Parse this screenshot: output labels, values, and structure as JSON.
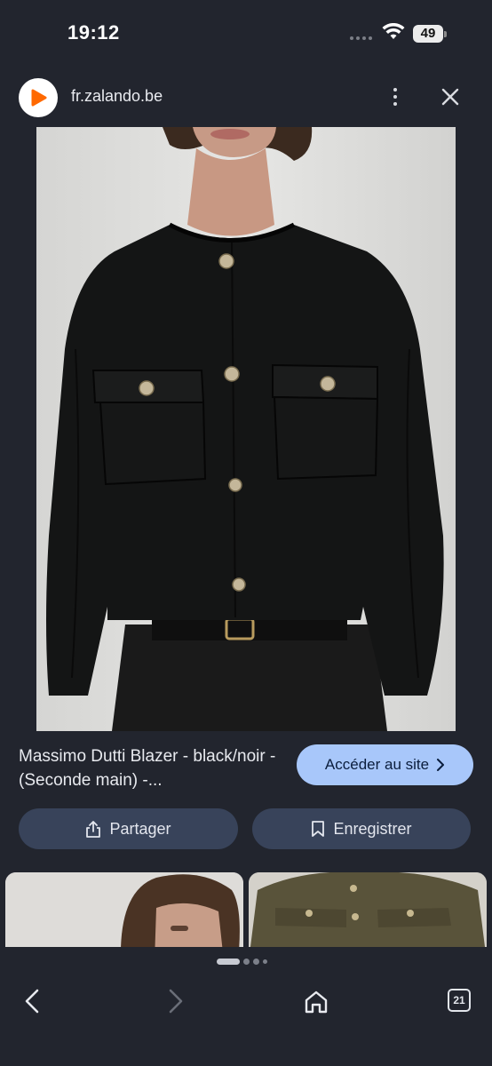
{
  "status_bar": {
    "time": "19:12",
    "battery": "49"
  },
  "browser": {
    "url": "fr.zalando.be",
    "site_icon": "zalando-play-icon",
    "menu_icon": "more-vertical-icon",
    "close_icon": "close-icon"
  },
  "result": {
    "title": "Massimo Dutti Blazer - black/noir - (Seconde main) -...",
    "visit_label": "Accéder au site",
    "share_label": "Partager",
    "save_label": "Enregistrer"
  },
  "bottom_nav": {
    "tab_count": "21",
    "icons": [
      "back-icon",
      "forward-icon",
      "home-icon",
      "tabs-icon"
    ]
  },
  "colors": {
    "background": "#22252e",
    "accent_button": "#a8c7fa",
    "secondary_button": "#38435a",
    "brand_orange": "#ff6900"
  }
}
